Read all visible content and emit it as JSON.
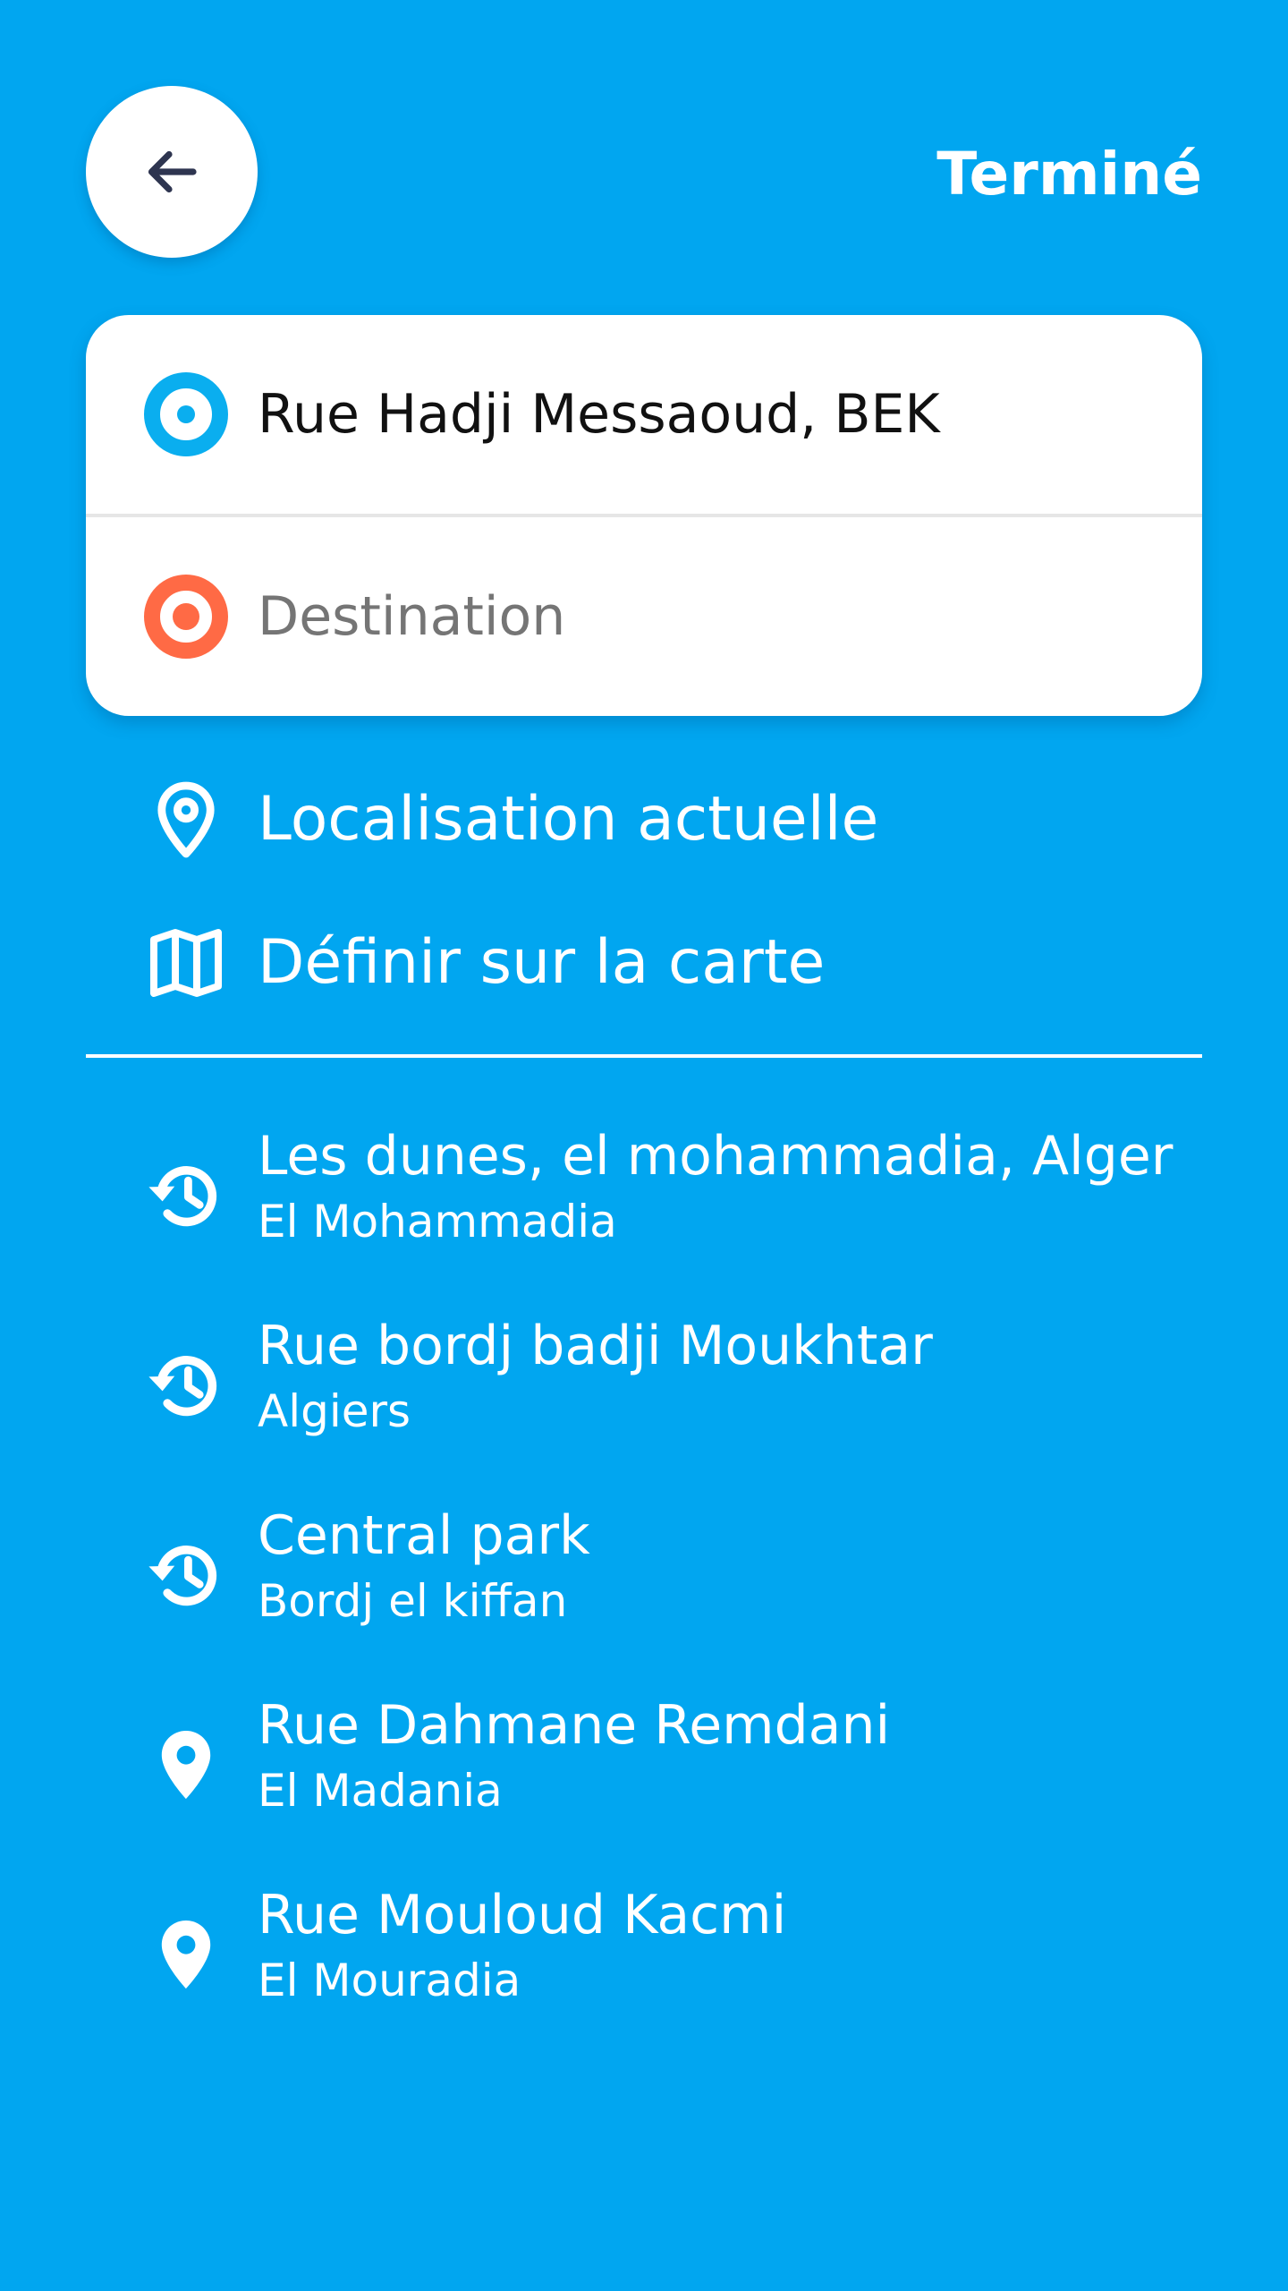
{
  "header": {
    "done_label": "Terminé"
  },
  "route": {
    "origin": {
      "value": "Rue Hadji Messaoud, BEK"
    },
    "destination": {
      "placeholder": "Destination"
    }
  },
  "quick_actions": [
    {
      "label": "Localisation actuelle",
      "icon": "location-pin-outline-icon"
    },
    {
      "label": "Définir sur la carte",
      "icon": "map-icon"
    }
  ],
  "recent_places": [
    {
      "title": "Les dunes, el mohammadia, Alger",
      "subtitle": "El Mohammadia",
      "icon": "history-icon"
    },
    {
      "title": "Rue bordj badji Moukhtar",
      "subtitle": "Algiers",
      "icon": "history-icon"
    },
    {
      "title": "Central park",
      "subtitle": "Bordj el kiffan",
      "icon": "history-icon"
    },
    {
      "title": "Rue Dahmane Remdani",
      "subtitle": "El Madania",
      "icon": "location-pin-icon"
    },
    {
      "title": "Rue Mouloud Kacmi",
      "subtitle": "El Mouradia",
      "icon": "location-pin-icon"
    }
  ],
  "colors": {
    "background": "#01A6F0",
    "origin_accent": "#0AAEEF",
    "destination_accent": "#FF6A45",
    "back_arrow": "#2E3550"
  }
}
